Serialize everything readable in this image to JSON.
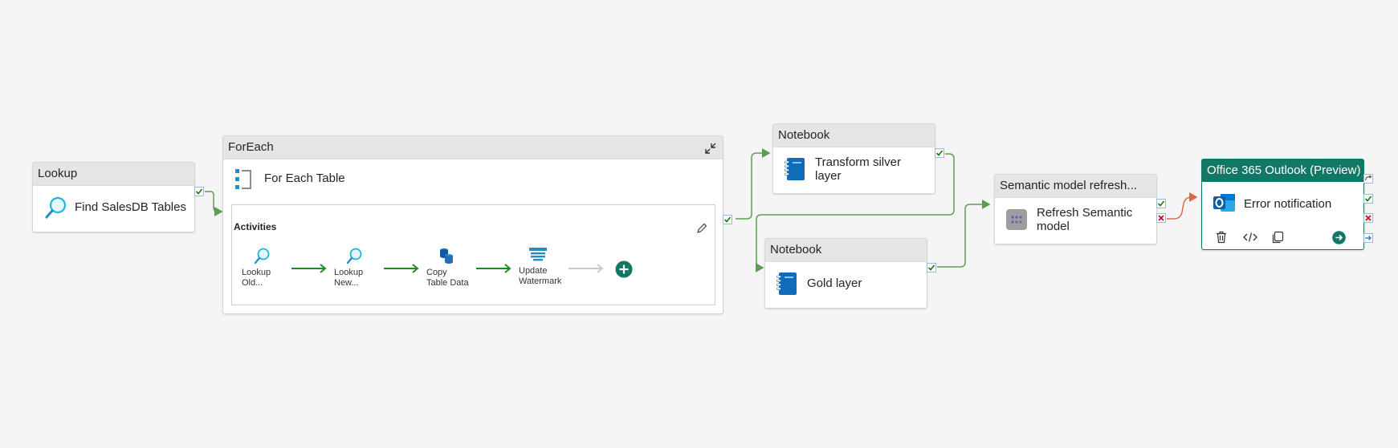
{
  "nodes": {
    "lookup": {
      "type": "Lookup",
      "name": "Find SalesDB Tables"
    },
    "foreach": {
      "type": "ForEach",
      "name": "For Each Table",
      "activities_title": "Activities",
      "activities": [
        {
          "line1": "Lookup",
          "line2": "Old..."
        },
        {
          "line1": "Lookup",
          "line2": "New..."
        },
        {
          "line1": "Copy",
          "line2": "Table Data"
        },
        {
          "line1": "Update",
          "line2": "Watermark"
        }
      ]
    },
    "notebook_silver": {
      "type": "Notebook",
      "name_line1": "Transform silver",
      "name_line2": "layer"
    },
    "notebook_gold": {
      "type": "Notebook",
      "name": "Gold layer"
    },
    "semantic": {
      "type": "Semantic model refresh...",
      "name_line1": "Refresh Semantic",
      "name_line2": "model"
    },
    "outlook": {
      "type": "Office 365 Outlook (Preview)",
      "name": "Error notification"
    }
  },
  "colors": {
    "success": "#107c10",
    "wire_success": "#5b9e4f",
    "failure": "#c50f1f",
    "wire_failure": "#d9694c",
    "accent": "#117865",
    "notebook_blue": "#0f6cbd"
  },
  "icons": {
    "lookup": "magnifier-icon",
    "foreach": "foreach-icon",
    "notebook": "notebook-icon",
    "semantic": "semantic-model-icon",
    "outlook": "outlook-icon",
    "copy": "copy-data-icon",
    "watermark": "stored-procedure-icon",
    "add": "add-activity-icon"
  }
}
